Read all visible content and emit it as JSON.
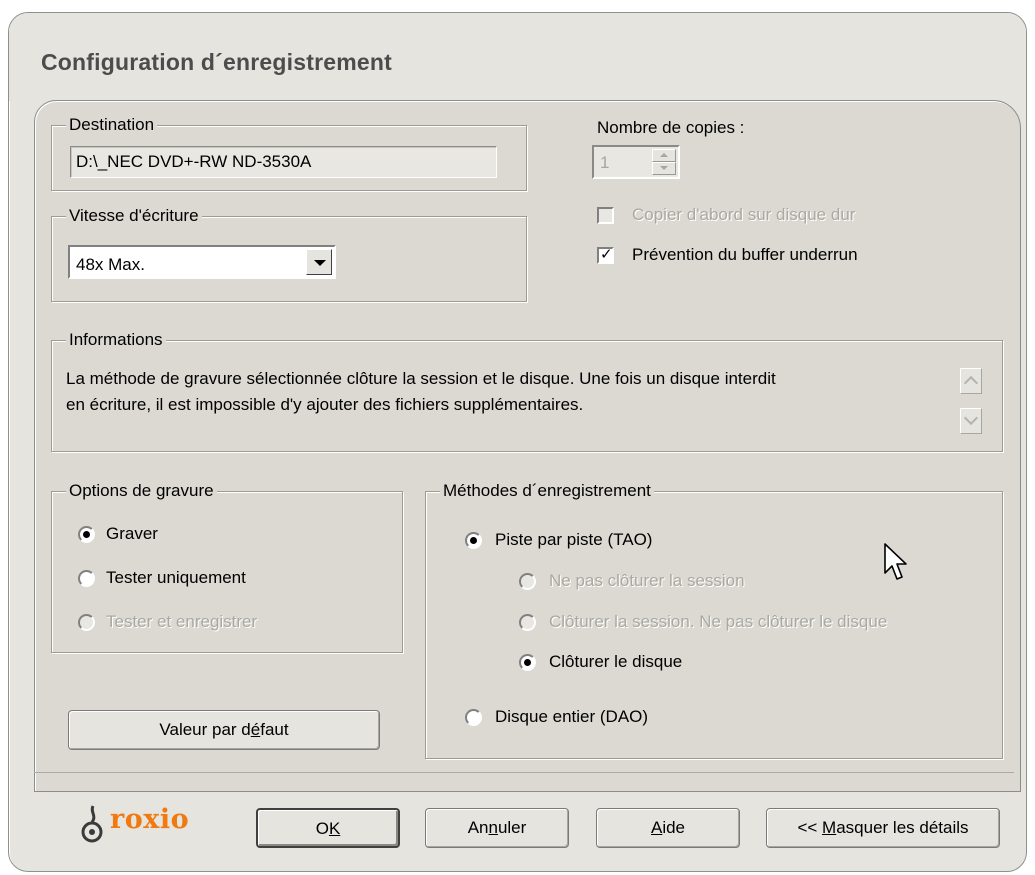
{
  "window": {
    "title": "Configuration d´enregistrement"
  },
  "destination": {
    "legend": "Destination",
    "value": "D:\\_NEC DVD+-RW ND-3530A"
  },
  "speed": {
    "legend": "Vitesse d'écriture",
    "selected": "48x  Max."
  },
  "copies": {
    "label": "Nombre de copies :",
    "value": "1",
    "copy_to_disk_label": "Copier d'abord sur disque dur",
    "copy_to_disk_checked": false,
    "copy_to_disk_enabled": false,
    "underrun_label": "Prévention du buffer underrun",
    "underrun_checked": true
  },
  "info": {
    "legend": "Informations",
    "line1": "La méthode de gravure sélectionnée clôture la session et le disque. Une fois un disque interdit",
    "line2": "en écriture, il est impossible d'y ajouter des fichiers supplémentaires."
  },
  "burn_options": {
    "legend": "Options de gravure",
    "items": [
      {
        "label": "Graver",
        "selected": true,
        "enabled": true
      },
      {
        "label": "Tester uniquement",
        "selected": false,
        "enabled": true
      },
      {
        "label": "Tester et enregistrer",
        "selected": false,
        "enabled": false
      }
    ]
  },
  "methods": {
    "legend": "Méthodes d´enregistrement",
    "tao": {
      "label": "Piste par piste (TAO)",
      "selected": true
    },
    "sub": [
      {
        "label": "Ne pas clôturer la session",
        "selected": false,
        "enabled": false
      },
      {
        "label": "Clôturer la session. Ne pas clôturer le disque",
        "selected": false,
        "enabled": false
      },
      {
        "label": "Clôturer le disque",
        "selected": true,
        "enabled": true
      }
    ],
    "dao": {
      "label": "Disque entier (DAO)",
      "selected": false
    }
  },
  "buttons": {
    "default_pre": "Valeur par d",
    "default_u": "é",
    "default_post": "faut",
    "ok_pre": "O",
    "ok_u": "K",
    "cancel_pre": "An",
    "cancel_u": "n",
    "cancel_post": "uler",
    "help_u": "A",
    "help_post": "ide",
    "hide_pre": "<< ",
    "hide_u": "M",
    "hide_post": "asquer les détails"
  },
  "brand": {
    "logo_text": "roxio",
    "logo_color": "#f07a10"
  },
  "colors": {
    "dialog_bg": "#e6e4df",
    "panel_bg": "#dbd9d2",
    "disabled_text": "#aaa8a2"
  }
}
